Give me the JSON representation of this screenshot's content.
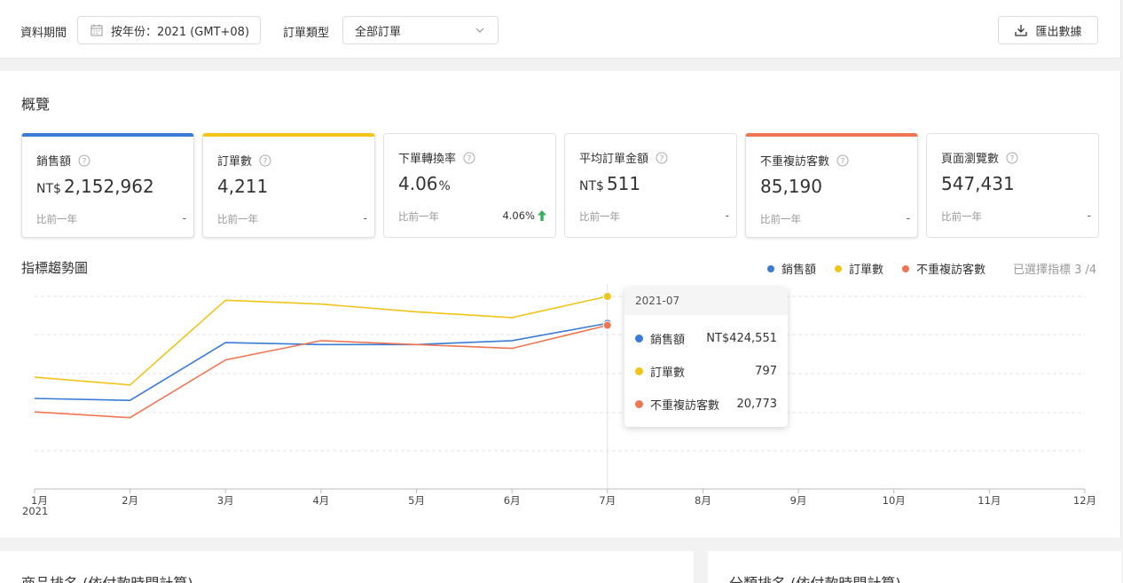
{
  "filters": {
    "period_label": "資料期間",
    "period_value": "按年份：2021 (GMT+08)",
    "order_type_label": "訂單類型",
    "order_type_value": "全部訂單",
    "export_label": "匯出數據"
  },
  "overview": {
    "title": "概覽",
    "cards": [
      {
        "title": "銷售額",
        "prefix": "NT$",
        "value": "2,152,962",
        "suffix": "",
        "compare_label": "比前一年",
        "compare_value": "-",
        "accent": "#3a7bd5"
      },
      {
        "title": "訂單數",
        "prefix": "",
        "value": "4,211",
        "suffix": "",
        "compare_label": "比前一年",
        "compare_value": "-",
        "accent": "#f0c419"
      },
      {
        "title": "下單轉換率",
        "prefix": "",
        "value": "4.06",
        "suffix": "%",
        "compare_label": "比前一年",
        "compare_value": "4.06%",
        "compare_trend": "up"
      },
      {
        "title": "平均訂單金額",
        "prefix": "NT$",
        "value": "511",
        "suffix": "",
        "compare_label": "比前一年",
        "compare_value": "-"
      },
      {
        "title": "不重複訪客數",
        "prefix": "",
        "value": "85,190",
        "suffix": "",
        "compare_label": "比前一年",
        "compare_value": "-",
        "accent": "#ee7652"
      },
      {
        "title": "頁面瀏覽數",
        "prefix": "",
        "value": "547,431",
        "suffix": "",
        "compare_label": "比前一年",
        "compare_value": "-"
      }
    ]
  },
  "trend": {
    "title": "指標趨勢圖",
    "legend": [
      {
        "name": "銷售額",
        "color": "#3a7bd5"
      },
      {
        "name": "訂單數",
        "color": "#f0c419"
      },
      {
        "name": "不重複訪客數",
        "color": "#ee7652"
      }
    ],
    "selected_label": "已選擇指標 3 /4",
    "tooltip": {
      "title": "2021-07",
      "rows": [
        {
          "name": "銷售額",
          "value": "NT$424,551",
          "color": "#3a7bd5"
        },
        {
          "name": "訂單數",
          "value": "797",
          "color": "#f0c419"
        },
        {
          "name": "不重複訪客數",
          "value": "20,773",
          "color": "#ee7652"
        }
      ]
    }
  },
  "chart_data": {
    "type": "line",
    "categories": [
      "1月",
      "2月",
      "3月",
      "4月",
      "5月",
      "6月",
      "7月",
      "8月",
      "9月",
      "10月",
      "11月",
      "12月"
    ],
    "year_label": "2021",
    "hover_index": 6,
    "grid": true,
    "legend_position": "top-right",
    "series": [
      {
        "name": "銷售額",
        "color": "#3a7bd5",
        "values": [
          0.47,
          0.46,
          0.76,
          0.75,
          0.75,
          0.77,
          0.86
        ]
      },
      {
        "name": "訂單數",
        "color": "#f0c419",
        "values": [
          0.58,
          0.54,
          0.98,
          0.96,
          0.92,
          0.89,
          1.0
        ]
      },
      {
        "name": "不重複訪客數",
        "color": "#ee7652",
        "values": [
          0.4,
          0.37,
          0.67,
          0.77,
          0.75,
          0.73,
          0.85
        ]
      }
    ]
  },
  "rankings": {
    "products_title": "商品排名 (依付款時間計算)",
    "categories_title": "分類排名 (依付款時間計算)"
  }
}
